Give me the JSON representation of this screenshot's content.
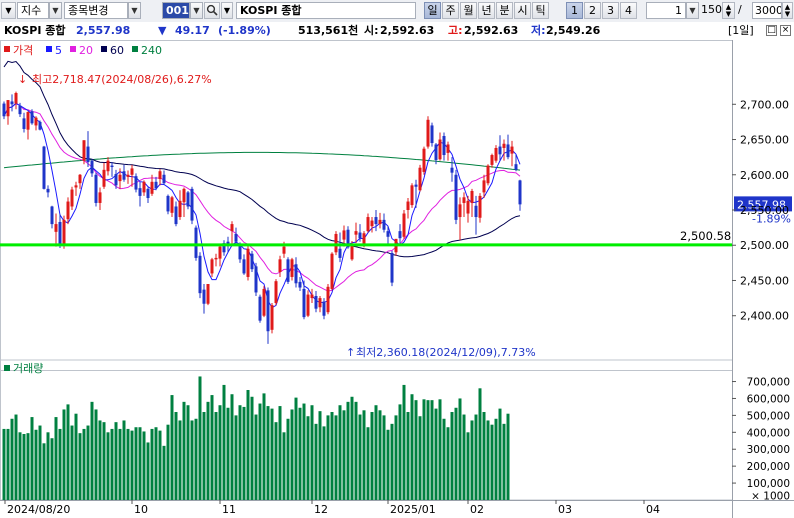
{
  "toolbar": {
    "market_label": "지수",
    "change_label": "종목변경",
    "code": "001",
    "name": "KOSPI 종합",
    "periods": [
      "일",
      "주",
      "월",
      "년",
      "분",
      "시",
      "틱"
    ],
    "selected_period": "일",
    "numbers": [
      "1",
      "2",
      "3",
      "4"
    ],
    "selected_number": "1",
    "unit_value": "1",
    "count_value": "150",
    "slash": "/",
    "total_value": "3000"
  },
  "info": {
    "name": "KOSPI 종합",
    "price": "2,557.98",
    "change_arrow": "▼",
    "change": "49.17",
    "change_pct": "(-1.89%)",
    "volume": "513,561천",
    "open_label": "시:",
    "open": "2,592.63",
    "high_label": "고:",
    "high": "2,592.63",
    "low_label": "저:",
    "low": "2,549.26",
    "period_badge": "[1일]"
  },
  "legend": {
    "price_label": "가격",
    "ma": [
      {
        "label": "5",
        "color": "#1a1aff"
      },
      {
        "label": "20",
        "color": "#e020e0"
      },
      {
        "label": "60",
        "color": "#000050"
      },
      {
        "label": "240",
        "color": "#008040"
      }
    ]
  },
  "annotations": {
    "high": "최고2,718.47(2024/08/26),6.27%",
    "low": "최저2,360.18(2024/12/09),7.73%",
    "support_level": "2,500.58",
    "current_price_tag": "2,557.98",
    "current_pct_tag": "-1.89%"
  },
  "volume_legend": "거래량",
  "x_labels": [
    "2024/08/20",
    "10",
    "11",
    "12",
    "2025/01",
    "02",
    "03",
    "04"
  ],
  "price_axis_ticks": [
    "2,700.00",
    "2,650.00",
    "2,600.00",
    "2,550.00",
    "2,500.00",
    "2,450.00",
    "2,400.00"
  ],
  "volume_axis_ticks": [
    "700,000",
    "600,000",
    "500,000",
    "400,000",
    "300,000",
    "200,000",
    "100,000",
    "× 1000"
  ],
  "colors": {
    "up": "#e01a1a",
    "down": "#1f35c9",
    "volume": "#008040",
    "support": "#00ee00",
    "ma5": "#1a1aff",
    "ma20": "#e020e0",
    "ma60": "#000050",
    "ma240": "#008040"
  },
  "chart_data": {
    "type": "candlestick",
    "period": "daily",
    "x_start": "2024/08/20",
    "y_price_range": [
      2340,
      2760
    ],
    "y_volume_range": [
      0,
      780
    ],
    "y_volume_unit": "× 1000",
    "candles": [
      [
        2701,
        2704,
        2679,
        2683
      ],
      [
        2683,
        2706,
        2671,
        2706
      ],
      [
        2704,
        2714,
        2690,
        2700
      ],
      [
        2701,
        2718,
        2693,
        2716
      ],
      [
        2698,
        2702,
        2682,
        2686
      ],
      [
        2680,
        2688,
        2660,
        2665
      ],
      [
        2664,
        2690,
        2650,
        2689
      ],
      [
        2690,
        2693,
        2671,
        2673
      ],
      [
        2670,
        2683,
        2663,
        2681
      ],
      [
        2675,
        2677,
        2663,
        2664
      ],
      [
        2640,
        2641,
        2579,
        2580
      ],
      [
        2580,
        2585,
        2568,
        2575
      ],
      [
        2555,
        2556,
        2524,
        2530
      ],
      [
        2519,
        2545,
        2498,
        2530
      ],
      [
        2533,
        2544,
        2496,
        2500
      ],
      [
        2500,
        2542,
        2495,
        2536
      ],
      [
        2537,
        2568,
        2530,
        2562
      ],
      [
        2555,
        2583,
        2550,
        2579
      ],
      [
        2582,
        2590,
        2570,
        2585
      ],
      [
        2588,
        2601,
        2580,
        2600
      ],
      [
        2620,
        2649,
        2615,
        2649
      ],
      [
        2640,
        2662,
        2611,
        2618
      ],
      [
        2620,
        2622,
        2597,
        2602
      ],
      [
        2600,
        2603,
        2555,
        2560
      ],
      [
        2560,
        2582,
        2550,
        2575
      ],
      [
        2583,
        2617,
        2580,
        2607
      ],
      [
        2605,
        2625,
        2599,
        2620
      ],
      [
        2613,
        2618,
        2597,
        2611
      ],
      [
        2601,
        2607,
        2580,
        2585
      ],
      [
        2591,
        2609,
        2580,
        2600
      ],
      [
        2605,
        2614,
        2590,
        2593
      ],
      [
        2597,
        2606,
        2587,
        2600
      ],
      [
        2600,
        2614,
        2583,
        2609
      ],
      [
        2598,
        2602,
        2575,
        2579
      ],
      [
        2581,
        2590,
        2555,
        2570
      ],
      [
        2575,
        2592,
        2570,
        2590
      ],
      [
        2580,
        2582,
        2560,
        2567
      ],
      [
        2573,
        2600,
        2570,
        2590
      ],
      [
        2590,
        2597,
        2578,
        2581
      ],
      [
        2594,
        2608,
        2585,
        2605
      ],
      [
        2600,
        2606,
        2586,
        2588
      ],
      [
        2570,
        2572,
        2544,
        2548
      ],
      [
        2546,
        2570,
        2540,
        2568
      ],
      [
        2555,
        2562,
        2527,
        2530
      ],
      [
        2540,
        2578,
        2536,
        2563
      ],
      [
        2561,
        2582,
        2540,
        2580
      ],
      [
        2575,
        2577,
        2551,
        2555
      ],
      [
        2580,
        2583,
        2530,
        2535
      ],
      [
        2525,
        2528,
        2478,
        2482
      ],
      [
        2485,
        2490,
        2425,
        2432
      ],
      [
        2437,
        2445,
        2403,
        2417
      ],
      [
        2417,
        2445,
        2415,
        2445
      ],
      [
        2460,
        2482,
        2455,
        2480
      ],
      [
        2480,
        2488,
        2470,
        2482
      ],
      [
        2481,
        2502,
        2470,
        2498
      ],
      [
        2503,
        2507,
        2485,
        2490
      ],
      [
        2505,
        2512,
        2490,
        2500
      ],
      [
        2520,
        2534,
        2500,
        2530
      ],
      [
        2516,
        2525,
        2500,
        2505
      ],
      [
        2502,
        2504,
        2475,
        2480
      ],
      [
        2480,
        2487,
        2458,
        2460
      ],
      [
        2455,
        2500,
        2450,
        2495
      ],
      [
        2488,
        2492,
        2462,
        2466
      ],
      [
        2470,
        2475,
        2428,
        2433
      ],
      [
        2427,
        2430,
        2390,
        2393
      ],
      [
        2400,
        2442,
        2398,
        2438
      ],
      [
        2436,
        2440,
        2360,
        2378
      ],
      [
        2380,
        2418,
        2375,
        2415
      ],
      [
        2418,
        2452,
        2415,
        2449
      ],
      [
        2462,
        2485,
        2455,
        2480
      ],
      [
        2488,
        2505,
        2482,
        2498
      ],
      [
        2480,
        2483,
        2445,
        2448
      ],
      [
        2455,
        2482,
        2450,
        2480
      ],
      [
        2473,
        2483,
        2440,
        2446
      ],
      [
        2448,
        2455,
        2435,
        2440
      ],
      [
        2438,
        2450,
        2395,
        2398
      ],
      [
        2400,
        2436,
        2398,
        2430
      ],
      [
        2425,
        2438,
        2418,
        2430
      ],
      [
        2428,
        2435,
        2405,
        2410
      ],
      [
        2412,
        2428,
        2405,
        2425
      ],
      [
        2420,
        2425,
        2395,
        2400
      ],
      [
        2405,
        2445,
        2402,
        2441
      ],
      [
        2438,
        2490,
        2436,
        2488
      ],
      [
        2490,
        2520,
        2486,
        2516
      ],
      [
        2495,
        2518,
        2476,
        2482
      ],
      [
        2508,
        2528,
        2498,
        2521
      ],
      [
        2522,
        2527,
        2495,
        2497
      ],
      [
        2480,
        2506,
        2478,
        2502
      ],
      [
        2515,
        2532,
        2503,
        2520
      ],
      [
        2518,
        2530,
        2505,
        2510
      ],
      [
        2500,
        2520,
        2497,
        2517
      ],
      [
        2520,
        2545,
        2518,
        2540
      ],
      [
        2527,
        2540,
        2518,
        2535
      ],
      [
        2540,
        2550,
        2520,
        2530
      ],
      [
        2530,
        2546,
        2524,
        2536
      ],
      [
        2536,
        2545,
        2518,
        2522
      ],
      [
        2520,
        2527,
        2501,
        2512
      ],
      [
        2489,
        2492,
        2442,
        2447
      ],
      [
        2490,
        2509,
        2485,
        2509
      ],
      [
        2520,
        2530,
        2500,
        2510
      ],
      [
        2512,
        2550,
        2509,
        2545
      ],
      [
        2550,
        2567,
        2538,
        2562
      ],
      [
        2557,
        2588,
        2553,
        2585
      ],
      [
        2586,
        2593,
        2553,
        2583
      ],
      [
        2578,
        2614,
        2576,
        2610
      ],
      [
        2604,
        2640,
        2600,
        2637
      ],
      [
        2640,
        2683,
        2637,
        2678
      ],
      [
        2670,
        2674,
        2640,
        2645
      ],
      [
        2643,
        2645,
        2615,
        2621
      ],
      [
        2622,
        2660,
        2620,
        2650
      ],
      [
        2655,
        2660,
        2620,
        2628
      ],
      [
        2631,
        2647,
        2620,
        2643
      ],
      [
        2610,
        2625,
        2590,
        2603
      ],
      [
        2600,
        2607,
        2530,
        2536
      ],
      [
        2540,
        2568,
        2507,
        2558
      ],
      [
        2560,
        2575,
        2540,
        2568
      ],
      [
        2545,
        2570,
        2532,
        2563
      ],
      [
        2560,
        2580,
        2540,
        2577
      ],
      [
        2556,
        2570,
        2515,
        2540
      ],
      [
        2539,
        2574,
        2532,
        2570
      ],
      [
        2575,
        2600,
        2567,
        2592
      ],
      [
        2588,
        2615,
        2585,
        2613
      ],
      [
        2614,
        2630,
        2610,
        2628
      ],
      [
        2620,
        2642,
        2617,
        2638
      ],
      [
        2640,
        2656,
        2620,
        2629
      ],
      [
        2638,
        2650,
        2620,
        2644
      ],
      [
        2643,
        2657,
        2622,
        2625
      ],
      [
        2630,
        2648,
        2612,
        2640
      ],
      [
        2615,
        2628,
        2605,
        2607
      ],
      [
        2592,
        2593,
        2549,
        2558
      ]
    ],
    "volume": [
      420,
      420,
      480,
      505,
      400,
      390,
      395,
      490,
      415,
      440,
      335,
      400,
      365,
      490,
      420,
      535,
      565,
      440,
      510,
      395,
      420,
      440,
      580,
      535,
      470,
      460,
      400,
      420,
      460,
      420,
      470,
      420,
      410,
      430,
      430,
      405,
      340,
      420,
      430,
      410,
      320,
      445,
      620,
      520,
      470,
      580,
      560,
      470,
      480,
      730,
      520,
      580,
      620,
      520,
      560,
      680,
      545,
      625,
      500,
      560,
      550,
      650,
      610,
      505,
      570,
      630,
      555,
      540,
      460,
      555,
      400,
      480,
      535,
      605,
      545,
      570,
      495,
      560,
      450,
      525,
      435,
      500,
      520,
      500,
      560,
      530,
      580,
      610,
      580,
      505,
      530,
      430,
      520,
      560,
      530,
      500,
      415,
      450,
      500,
      565,
      680,
      520,
      625,
      590,
      495,
      595,
      590,
      590,
      540,
      595,
      480,
      430,
      520,
      545,
      600,
      505,
      400,
      470,
      505,
      660,
      520,
      470,
      445,
      480,
      540,
      450,
      510
    ],
    "ma": [
      "5",
      "20",
      "60",
      "240"
    ],
    "support_level": 2500.58,
    "high": {
      "value": 2718.47,
      "date": "2024/08/26",
      "pct": 6.27
    },
    "low": {
      "value": 2360.18,
      "date": "2024/12/09",
      "pct": 7.73
    },
    "last": 2557.98
  }
}
